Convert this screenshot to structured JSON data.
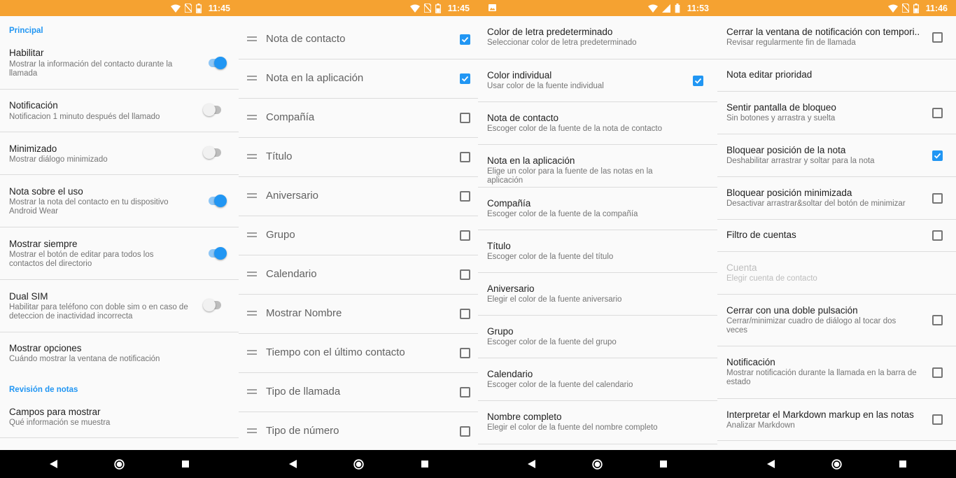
{
  "screens": [
    {
      "time": "11:45"
    },
    {
      "time": "11:45"
    },
    {
      "time": "11:53"
    },
    {
      "time": "11:46"
    }
  ],
  "panel1": {
    "header_principal": "Principal",
    "header_revision": "Revisión de notas",
    "items": [
      {
        "title": "Habilitar",
        "subtitle": "Mostrar la información del contacto durante la llamada",
        "toggle": true
      },
      {
        "title": "Notificación",
        "subtitle": "Notificacion 1 minuto después del llamado",
        "toggle": false
      },
      {
        "title": "Minimizado",
        "subtitle": "Mostrar diálogo minimizado",
        "toggle": false
      },
      {
        "title": "Nota sobre el uso",
        "subtitle": "Mostrar la nota del contacto en tu dispositivo Android Wear",
        "toggle": true
      },
      {
        "title": "Mostrar siempre",
        "subtitle": "Mostrar el botón de editar para todos los contactos del directorio",
        "toggle": true
      },
      {
        "title": "Dual SIM",
        "subtitle": "Habilitar para teléfono con doble sim o en caso de deteccion de inactividad incorrecta",
        "toggle": false
      },
      {
        "title": "Mostrar opciones",
        "subtitle": "Cuándo mostrar la ventana de notificación"
      },
      {
        "title": "Campos para mostrar",
        "subtitle": "Qué información se muestra"
      }
    ]
  },
  "panel2": {
    "items": [
      {
        "label": "Nota de contacto",
        "checked": true
      },
      {
        "label": "Nota en la aplicación",
        "checked": true
      },
      {
        "label": "Compañía",
        "checked": false
      },
      {
        "label": "Título",
        "checked": false
      },
      {
        "label": "Aniversario",
        "checked": false
      },
      {
        "label": "Grupo",
        "checked": false
      },
      {
        "label": "Calendario",
        "checked": false
      },
      {
        "label": "Mostrar Nombre",
        "checked": false
      },
      {
        "label": "Tiempo con el último contacto",
        "checked": false
      },
      {
        "label": "Tipo de llamada",
        "checked": false
      },
      {
        "label": "Tipo de número",
        "checked": false
      }
    ]
  },
  "panel3": {
    "items": [
      {
        "title": "Color de letra predeterminado",
        "subtitle": "Seleccionar color de letra predeterminado"
      },
      {
        "title": "Color individual",
        "subtitle": "Usar color de la fuente individual",
        "checked": true
      },
      {
        "title": "Nota de contacto",
        "subtitle": "Escoger color de la fuente de la nota de contacto"
      },
      {
        "title": "Nota en la aplicación",
        "subtitle": "Elige un color para la fuente de las notas en la aplicación"
      },
      {
        "title": "Compañía",
        "subtitle": "Escoger color de la fuente de la compañía"
      },
      {
        "title": "Título",
        "subtitle": "Escoger color de la fuente del título"
      },
      {
        "title": "Aniversario",
        "subtitle": "Elegir el color de la fuente aniversario"
      },
      {
        "title": "Grupo",
        "subtitle": "Escoger color de la fuente del grupo"
      },
      {
        "title": "Calendario",
        "subtitle": "Escoger color de la fuente del calendario"
      },
      {
        "title": "Nombre completo",
        "subtitle": "Elegir el color de la fuente del nombre completo"
      }
    ]
  },
  "panel4": {
    "items": [
      {
        "title": "Cerrar la ventana de notificación con tempori..",
        "subtitle": "Revisar regularmente fin de llamada",
        "checked": false
      },
      {
        "title": "Nota editar prioridad"
      },
      {
        "title": "Sentir pantalla de bloqueo",
        "subtitle": "Sin botones y arrastra y suelta",
        "checked": false
      },
      {
        "title": "Bloquear posición de la nota",
        "subtitle": "Deshabilitar arrastrar y soltar para la nota",
        "checked": true
      },
      {
        "title": "Bloquear posición minimizada",
        "subtitle": "Desactivar arrastrar&soltar del botón de minimizar",
        "checked": false
      },
      {
        "title": "Filtro de cuentas",
        "checked": false
      },
      {
        "title": "Cuenta",
        "subtitle": "Elegir cuenta de contacto",
        "disabled": true
      },
      {
        "title": "Cerrar con una doble pulsación",
        "subtitle": "Cerrar/minimizar cuadro de diálogo al tocar dos veces",
        "checked": false
      },
      {
        "title": "Notificación",
        "subtitle": "Mostrar notificación durante la llamada en la barra de estado",
        "checked": false
      },
      {
        "title": "Interpretar el Markdown markup en las notas",
        "subtitle": "Analizar Markdown",
        "checked": false
      }
    ]
  },
  "icons": {
    "status": [
      "wifi-icon",
      "no-sim-icon",
      "battery-icon",
      "signal-icon",
      "image-icon"
    ],
    "nav": [
      "back-icon",
      "home-icon",
      "recents-icon"
    ]
  },
  "colors": {
    "status_bar": "#f5a231",
    "accent": "#2196f3",
    "background": "#fafafa",
    "nav_bar": "#000000"
  }
}
